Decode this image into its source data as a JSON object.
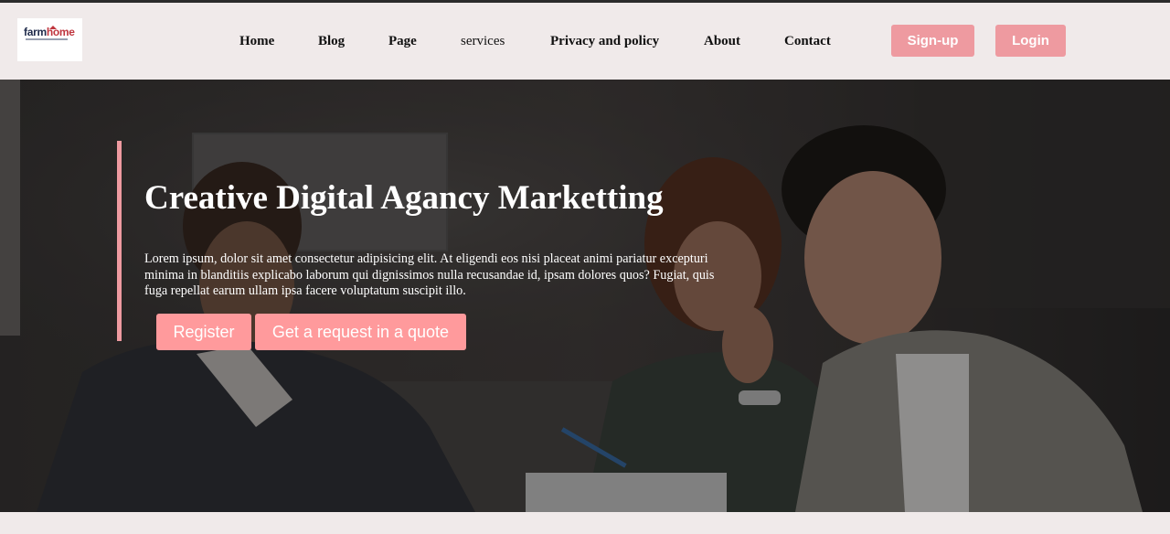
{
  "header": {
    "logo": {
      "part1": "farm",
      "part2": "home"
    },
    "nav": [
      {
        "label": "Home"
      },
      {
        "label": "Blog"
      },
      {
        "label": "Page"
      },
      {
        "label": "services"
      },
      {
        "label": "Privacy and policy"
      },
      {
        "label": "About"
      },
      {
        "label": "Contact"
      }
    ],
    "signup_label": "Sign-up",
    "login_label": "Login",
    "accent_color": "#ee9aa0"
  },
  "hero": {
    "title": "Creative Digital Agancy Marketting",
    "text": "Lorem ipsum, dolor sit amet consectetur adipisicing elit. At eligendi eos nisi placeat animi pariatur excepturi minima in blanditiis explicabo laborum qui dignissimos nulla recusandae id, ipsam dolores quos? Fugiat, quis fuga repellat earum ullam ipsa facere voluptatum suscipit illo.",
    "register_label": "Register",
    "quote_label": "Get a request in a quote",
    "button_color": "#ff9a9c"
  }
}
